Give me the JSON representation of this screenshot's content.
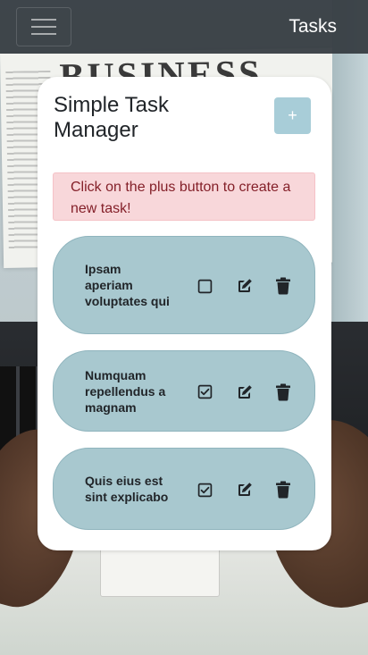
{
  "navbar": {
    "toggler_icon": "hamburger-icon",
    "brand": "Tasks"
  },
  "card": {
    "title": "Simple Task Manager",
    "add_button": "+",
    "alert": "Click on the plus button to create a new task!"
  },
  "tasks": [
    {
      "text": "Ipsam aperiam voluptates qui",
      "completed": false
    },
    {
      "text": "Numquam repellendus a magnam",
      "completed": true
    },
    {
      "text": "Quis eius est sint explicabo",
      "completed": true
    }
  ],
  "colors": {
    "navbar": "#343a40",
    "task_bg": "#a8c8cf",
    "add_button": "#a8cdd8",
    "alert_bg": "#f8d7da",
    "alert_text": "#842029"
  },
  "icons": {
    "check_unchecked": "square-icon",
    "check_checked": "check-square-icon",
    "edit": "pencil-square-icon",
    "delete": "trash-icon"
  }
}
